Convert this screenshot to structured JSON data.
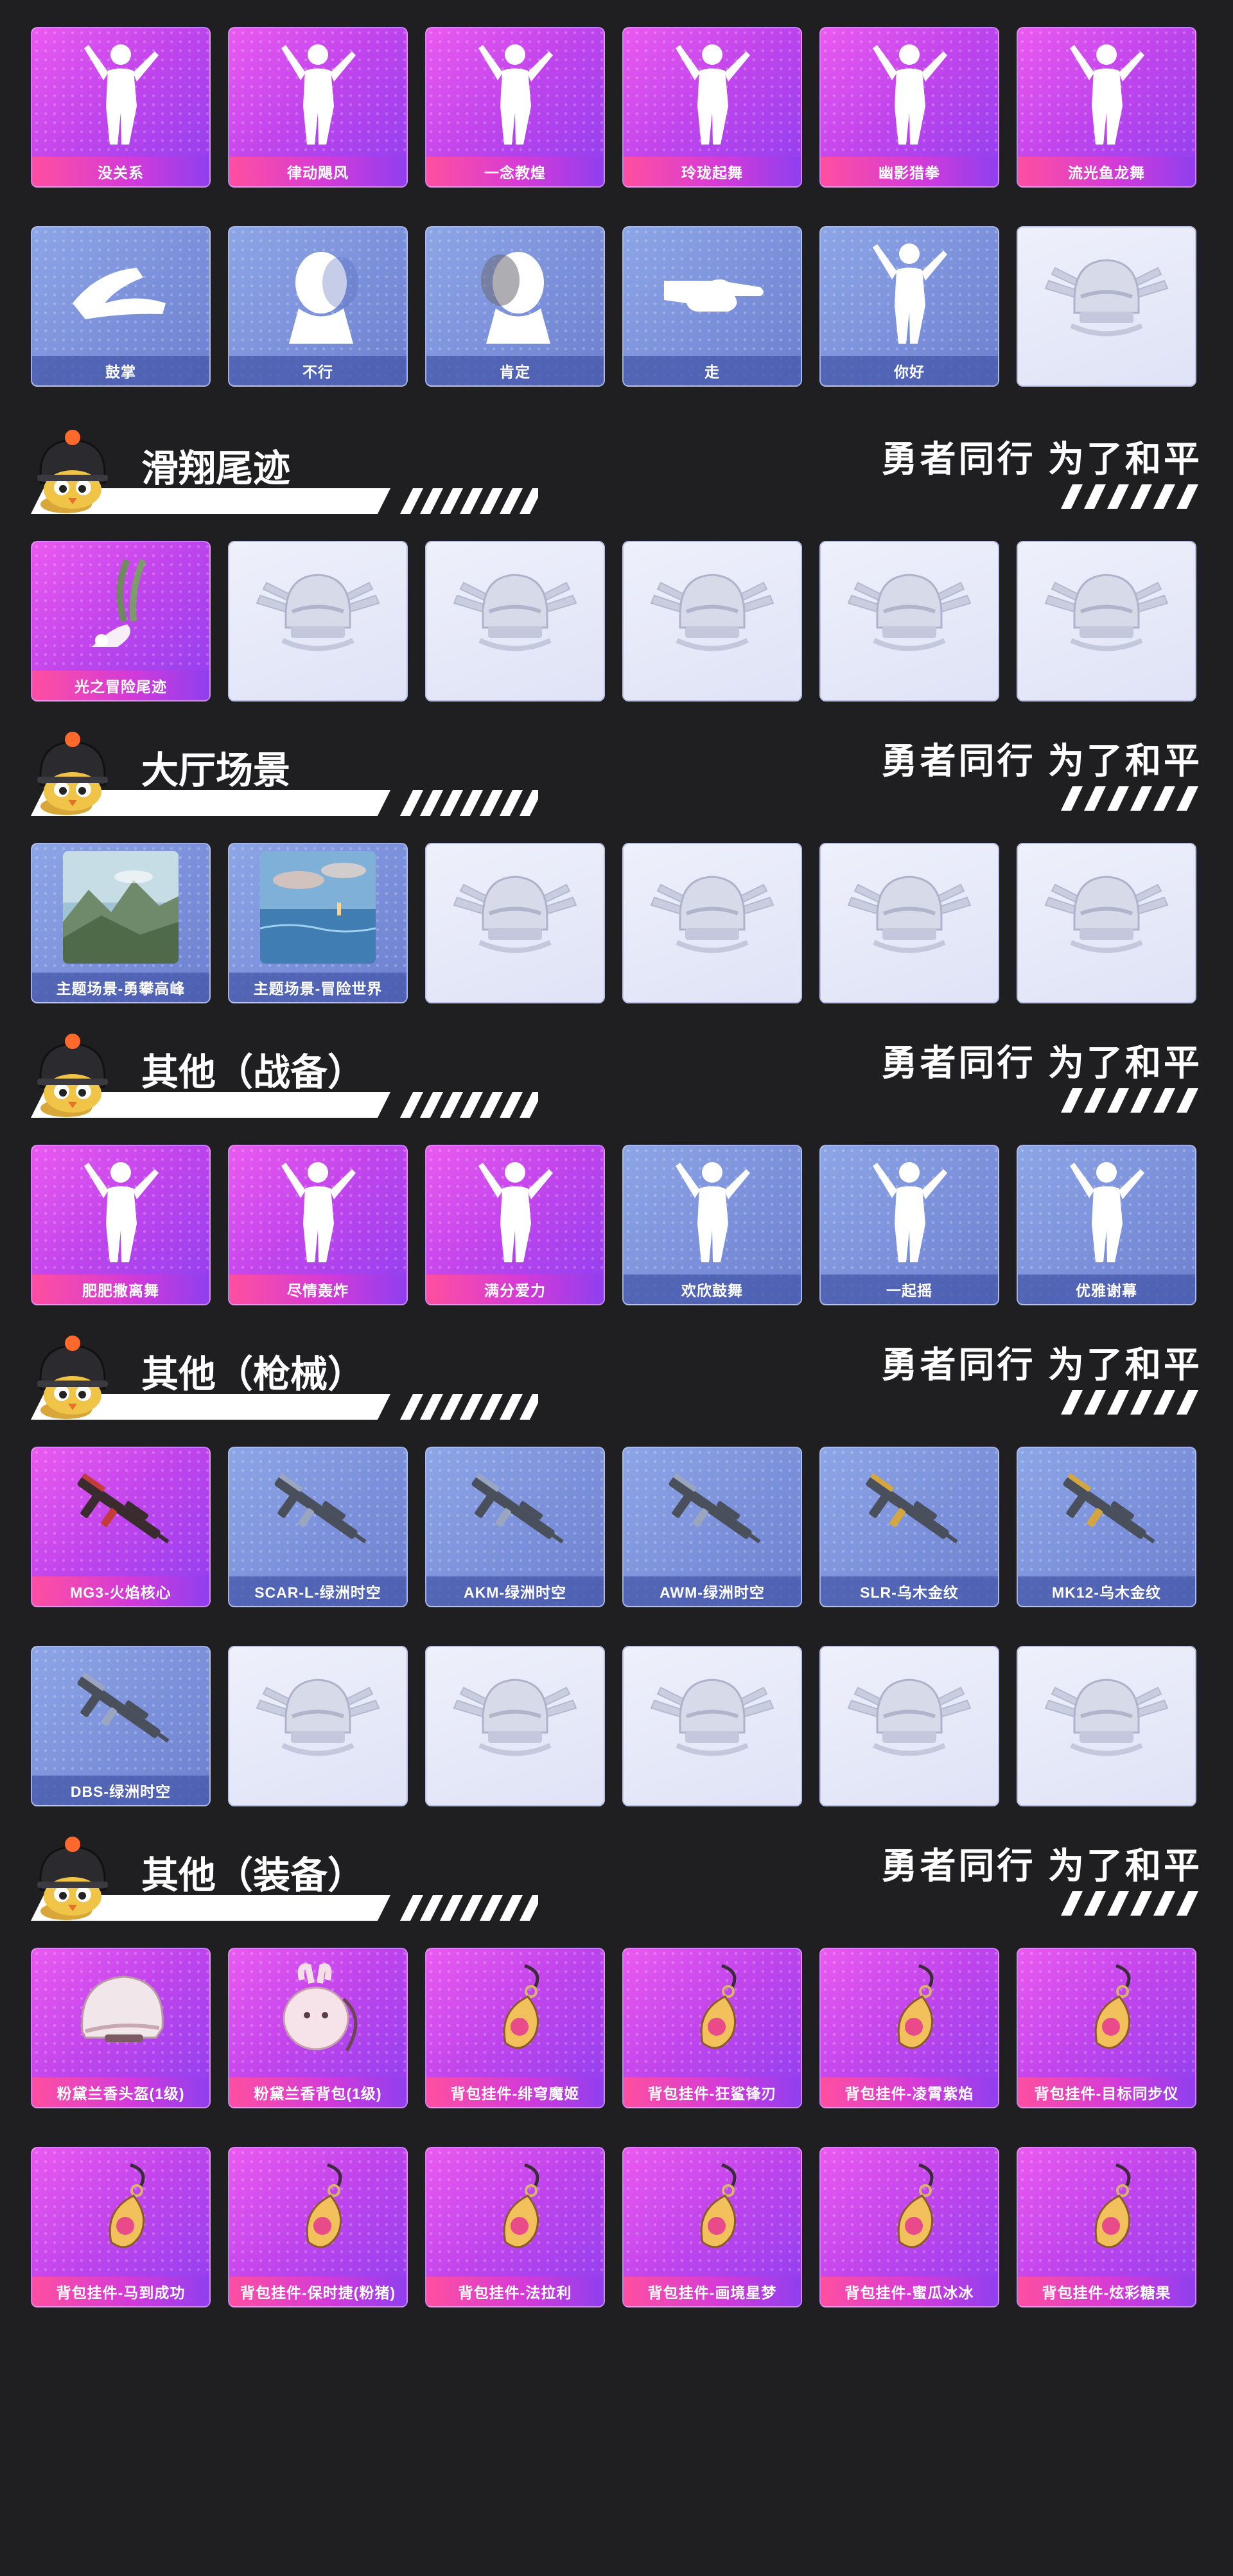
{
  "slogan": "勇者同行 为了和平",
  "top_rows": [
    [
      {
        "label": "没关系",
        "style": "pink",
        "icon": "dancer-icon"
      },
      {
        "label": "律动飓风",
        "style": "pink",
        "icon": "dancer-icon"
      },
      {
        "label": "一念教煌",
        "style": "pink",
        "icon": "dancer-icon"
      },
      {
        "label": "玲珑起舞",
        "style": "pink",
        "icon": "dancer-icon"
      },
      {
        "label": "幽影猎拳",
        "style": "pink",
        "icon": "dancer-icon"
      },
      {
        "label": "流光鱼龙舞",
        "style": "pink",
        "icon": "dancer-icon"
      }
    ],
    [
      {
        "label": "鼓掌",
        "style": "blue",
        "icon": "clapping-hands-icon"
      },
      {
        "label": "不行",
        "style": "blue",
        "icon": "head-shake-icon"
      },
      {
        "label": "肯定",
        "style": "blue",
        "icon": "head-nod-icon"
      },
      {
        "label": "走",
        "style": "blue",
        "icon": "pointing-hand-icon"
      },
      {
        "label": "你好",
        "style": "blue",
        "icon": "waving-person-icon"
      },
      {
        "label": "",
        "style": "empty",
        "icon": "helmet-emblem-icon"
      }
    ]
  ],
  "sections": [
    {
      "title": "滑翔尾迹",
      "rows": [
        [
          {
            "label": "光之冒险尾迹",
            "style": "pink",
            "icon": "glide-trail-icon"
          },
          {
            "label": "",
            "style": "empty",
            "icon": "helmet-emblem-icon"
          },
          {
            "label": "",
            "style": "empty",
            "icon": "helmet-emblem-icon"
          },
          {
            "label": "",
            "style": "empty",
            "icon": "helmet-emblem-icon"
          },
          {
            "label": "",
            "style": "empty",
            "icon": "helmet-emblem-icon"
          },
          {
            "label": "",
            "style": "empty",
            "icon": "helmet-emblem-icon"
          }
        ]
      ]
    },
    {
      "title": "大厅场景",
      "rows": [
        [
          {
            "label": "主题场景-勇攀高峰",
            "style": "blue",
            "icon": "mountain-scene-icon"
          },
          {
            "label": "主题场景-冒险世界",
            "style": "blue",
            "icon": "ocean-scene-icon"
          },
          {
            "label": "",
            "style": "empty",
            "icon": "helmet-emblem-icon"
          },
          {
            "label": "",
            "style": "empty",
            "icon": "helmet-emblem-icon"
          },
          {
            "label": "",
            "style": "empty",
            "icon": "helmet-emblem-icon"
          },
          {
            "label": "",
            "style": "empty",
            "icon": "helmet-emblem-icon"
          }
        ]
      ]
    },
    {
      "title": "其他（战备）",
      "rows": [
        [
          {
            "label": "肥肥撒离舞",
            "style": "pink",
            "icon": "dancer-icon"
          },
          {
            "label": "尽情轰炸",
            "style": "pink",
            "icon": "dancer-icon"
          },
          {
            "label": "满分爱力",
            "style": "pink",
            "icon": "dancer-icon"
          },
          {
            "label": "欢欣鼓舞",
            "style": "blue",
            "icon": "cheering-person-icon"
          },
          {
            "label": "一起摇",
            "style": "blue",
            "icon": "dancer-icon"
          },
          {
            "label": "优雅谢幕",
            "style": "blue",
            "icon": "bowing-person-icon"
          }
        ]
      ]
    },
    {
      "title": "其他（枪械）",
      "rows": [
        [
          {
            "label": "MG3-火焰核心",
            "style": "pink",
            "icon": "machine-gun-icon"
          },
          {
            "label": "SCAR-L-绿洲时空",
            "style": "blue",
            "icon": "rifle-icon"
          },
          {
            "label": "AKM-绿洲时空",
            "style": "blue",
            "icon": "rifle-icon"
          },
          {
            "label": "AWM-绿洲时空",
            "style": "blue",
            "icon": "sniper-rifle-icon"
          },
          {
            "label": "SLR-乌木金纹",
            "style": "blue",
            "icon": "gold-rifle-icon"
          },
          {
            "label": "MK12-乌木金纹",
            "style": "blue",
            "icon": "gold-rifle-icon"
          }
        ],
        [
          {
            "label": "DBS-绿洲时空",
            "style": "blue",
            "icon": "shotgun-icon"
          },
          {
            "label": "",
            "style": "empty",
            "icon": "helmet-emblem-icon"
          },
          {
            "label": "",
            "style": "empty",
            "icon": "helmet-emblem-icon"
          },
          {
            "label": "",
            "style": "empty",
            "icon": "helmet-emblem-icon"
          },
          {
            "label": "",
            "style": "empty",
            "icon": "helmet-emblem-icon"
          },
          {
            "label": "",
            "style": "empty",
            "icon": "helmet-emblem-icon"
          }
        ]
      ]
    },
    {
      "title": "其他（装备）",
      "rows": [
        [
          {
            "label": "粉黛兰香头盔(1级)",
            "style": "pink",
            "icon": "helmet-icon"
          },
          {
            "label": "粉黛兰香背包(1级)",
            "style": "pink",
            "icon": "backpack-icon"
          },
          {
            "label": "背包挂件-绯穹魔姬",
            "style": "pink",
            "icon": "pendant-icon"
          },
          {
            "label": "背包挂件-狂鲨锋刃",
            "style": "pink",
            "icon": "pendant-icon"
          },
          {
            "label": "背包挂件-凌霄紫焰",
            "style": "pink",
            "icon": "pendant-icon"
          },
          {
            "label": "背包挂件-目标同步仪",
            "style": "pink",
            "icon": "pendant-icon"
          }
        ],
        [
          {
            "label": "背包挂件-马到成功",
            "style": "pink",
            "icon": "pendant-icon"
          },
          {
            "label": "背包挂件-保时捷(粉猪)",
            "style": "pink",
            "icon": "pendant-icon"
          },
          {
            "label": "背包挂件-法拉利",
            "style": "pink",
            "icon": "pendant-icon"
          },
          {
            "label": "背包挂件-画境星梦",
            "style": "pink",
            "icon": "pendant-icon"
          },
          {
            "label": "背包挂件-蜜瓜冰冰",
            "style": "pink",
            "icon": "pendant-icon"
          },
          {
            "label": "背包挂件-炫彩糖果",
            "style": "pink",
            "icon": "pendant-icon"
          }
        ]
      ]
    }
  ]
}
